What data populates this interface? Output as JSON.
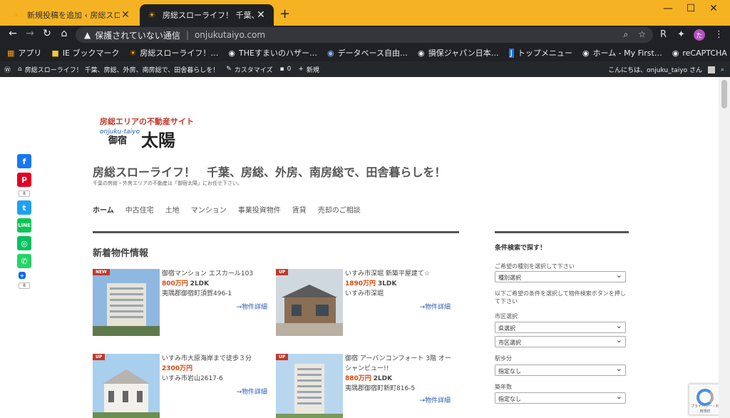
{
  "browser": {
    "tabs": [
      {
        "title": "新規投稿を追加 ‹ 房総スローラ…"
      },
      {
        "title": "房総スローライフ！ 千葉、房総…"
      }
    ],
    "window_controls": {
      "minimize": "—",
      "maximize": "☐",
      "close": "✕"
    },
    "address": {
      "security": "保護されていない通信",
      "url": "onjukutaiyo.com"
    },
    "profile_initial": "た",
    "bookmarks": [
      {
        "label": "アプリ",
        "icon": "apps-icon"
      },
      {
        "label": "IE ブックマーク",
        "icon": "folder-icon"
      },
      {
        "label": "房総スローライフ！…",
        "icon": "sun-icon"
      },
      {
        "label": "THEすまいのハザー…",
        "icon": "globe-icon"
      },
      {
        "label": "データベース自由…",
        "icon": "globe-icon"
      },
      {
        "label": "損保ジャパン日本…",
        "icon": "globe-icon"
      },
      {
        "label": "トップメニュー",
        "icon": "j-icon"
      },
      {
        "label": "ホーム - My First…",
        "icon": "globe-icon"
      },
      {
        "label": "reCAPTCHA",
        "icon": "globe-icon"
      }
    ]
  },
  "wpbar": {
    "site": "房総スローライフ！ 千葉、房総、外房、南房総で、田舎暮らしを！",
    "customize": "カスタマイズ",
    "comments": "0",
    "new": "新規",
    "greeting": "こんにちは、onjuku_taiyo さん"
  },
  "logo": {
    "line1": "房総エリアの不動産サイト",
    "line2": "onjuku-taiyo",
    "line3": "御宿",
    "line4": "太陽"
  },
  "site": {
    "title": "房総スローライフ！　千葉、房総、外房、南房総で、田舎暮らしを！",
    "tagline": "千葉の房総・外房エリアの不動産は「御宿太陽」にお任せ下さい。"
  },
  "nav": [
    "ホーム",
    "中古住宅",
    "土地",
    "マンション",
    "事業投資物件",
    "賃貸",
    "売却のご相談"
  ],
  "section_title": "新着物件情報",
  "listings": [
    {
      "badge": "NEW",
      "title": "御宿マンション エスカール103",
      "price": "800万円",
      "layout": "2LDK",
      "address": "夷隅郡御宿町須賀496-1",
      "detail": "→物件詳細"
    },
    {
      "badge": "UP",
      "title": "いすみ市深堀 新築平屋建て☆",
      "price": "1890万円",
      "layout": "3LDK",
      "address": "いすみ市深堀",
      "detail": "→物件詳細"
    },
    {
      "badge": "UP",
      "title": "いすみ市大原海岸まで徒歩３分",
      "price": "2300万円",
      "layout": "",
      "address": "いすみ市岩山2617-6",
      "detail": "→物件詳細"
    },
    {
      "badge": "UP",
      "title": "御宿 アーバンコンフォート 3階 オーシャンビュー!!",
      "price": "880万円",
      "layout": "2LDK",
      "address": "夷隅郡御宿町新町816-5",
      "detail": "→物件詳細"
    }
  ],
  "sidebar": {
    "title": "条件検索で探す！",
    "type_label": "ご希望の種別を選択して下さい",
    "type_select": "種別選択",
    "desc": "以下ご希望の条件を選択して物件検索ボタンを押して下さい",
    "area_label": "市区選択",
    "pref_select": "県選択",
    "city_select": "市区選択",
    "walk_label": "駅歩分",
    "walk_select": "指定なし",
    "age_label": "築年数",
    "age_select": "指定なし"
  },
  "share": {
    "pinterest_count": "8",
    "plus_count": "8"
  },
  "captcha": {
    "text": "プライバシー・利用規約"
  }
}
